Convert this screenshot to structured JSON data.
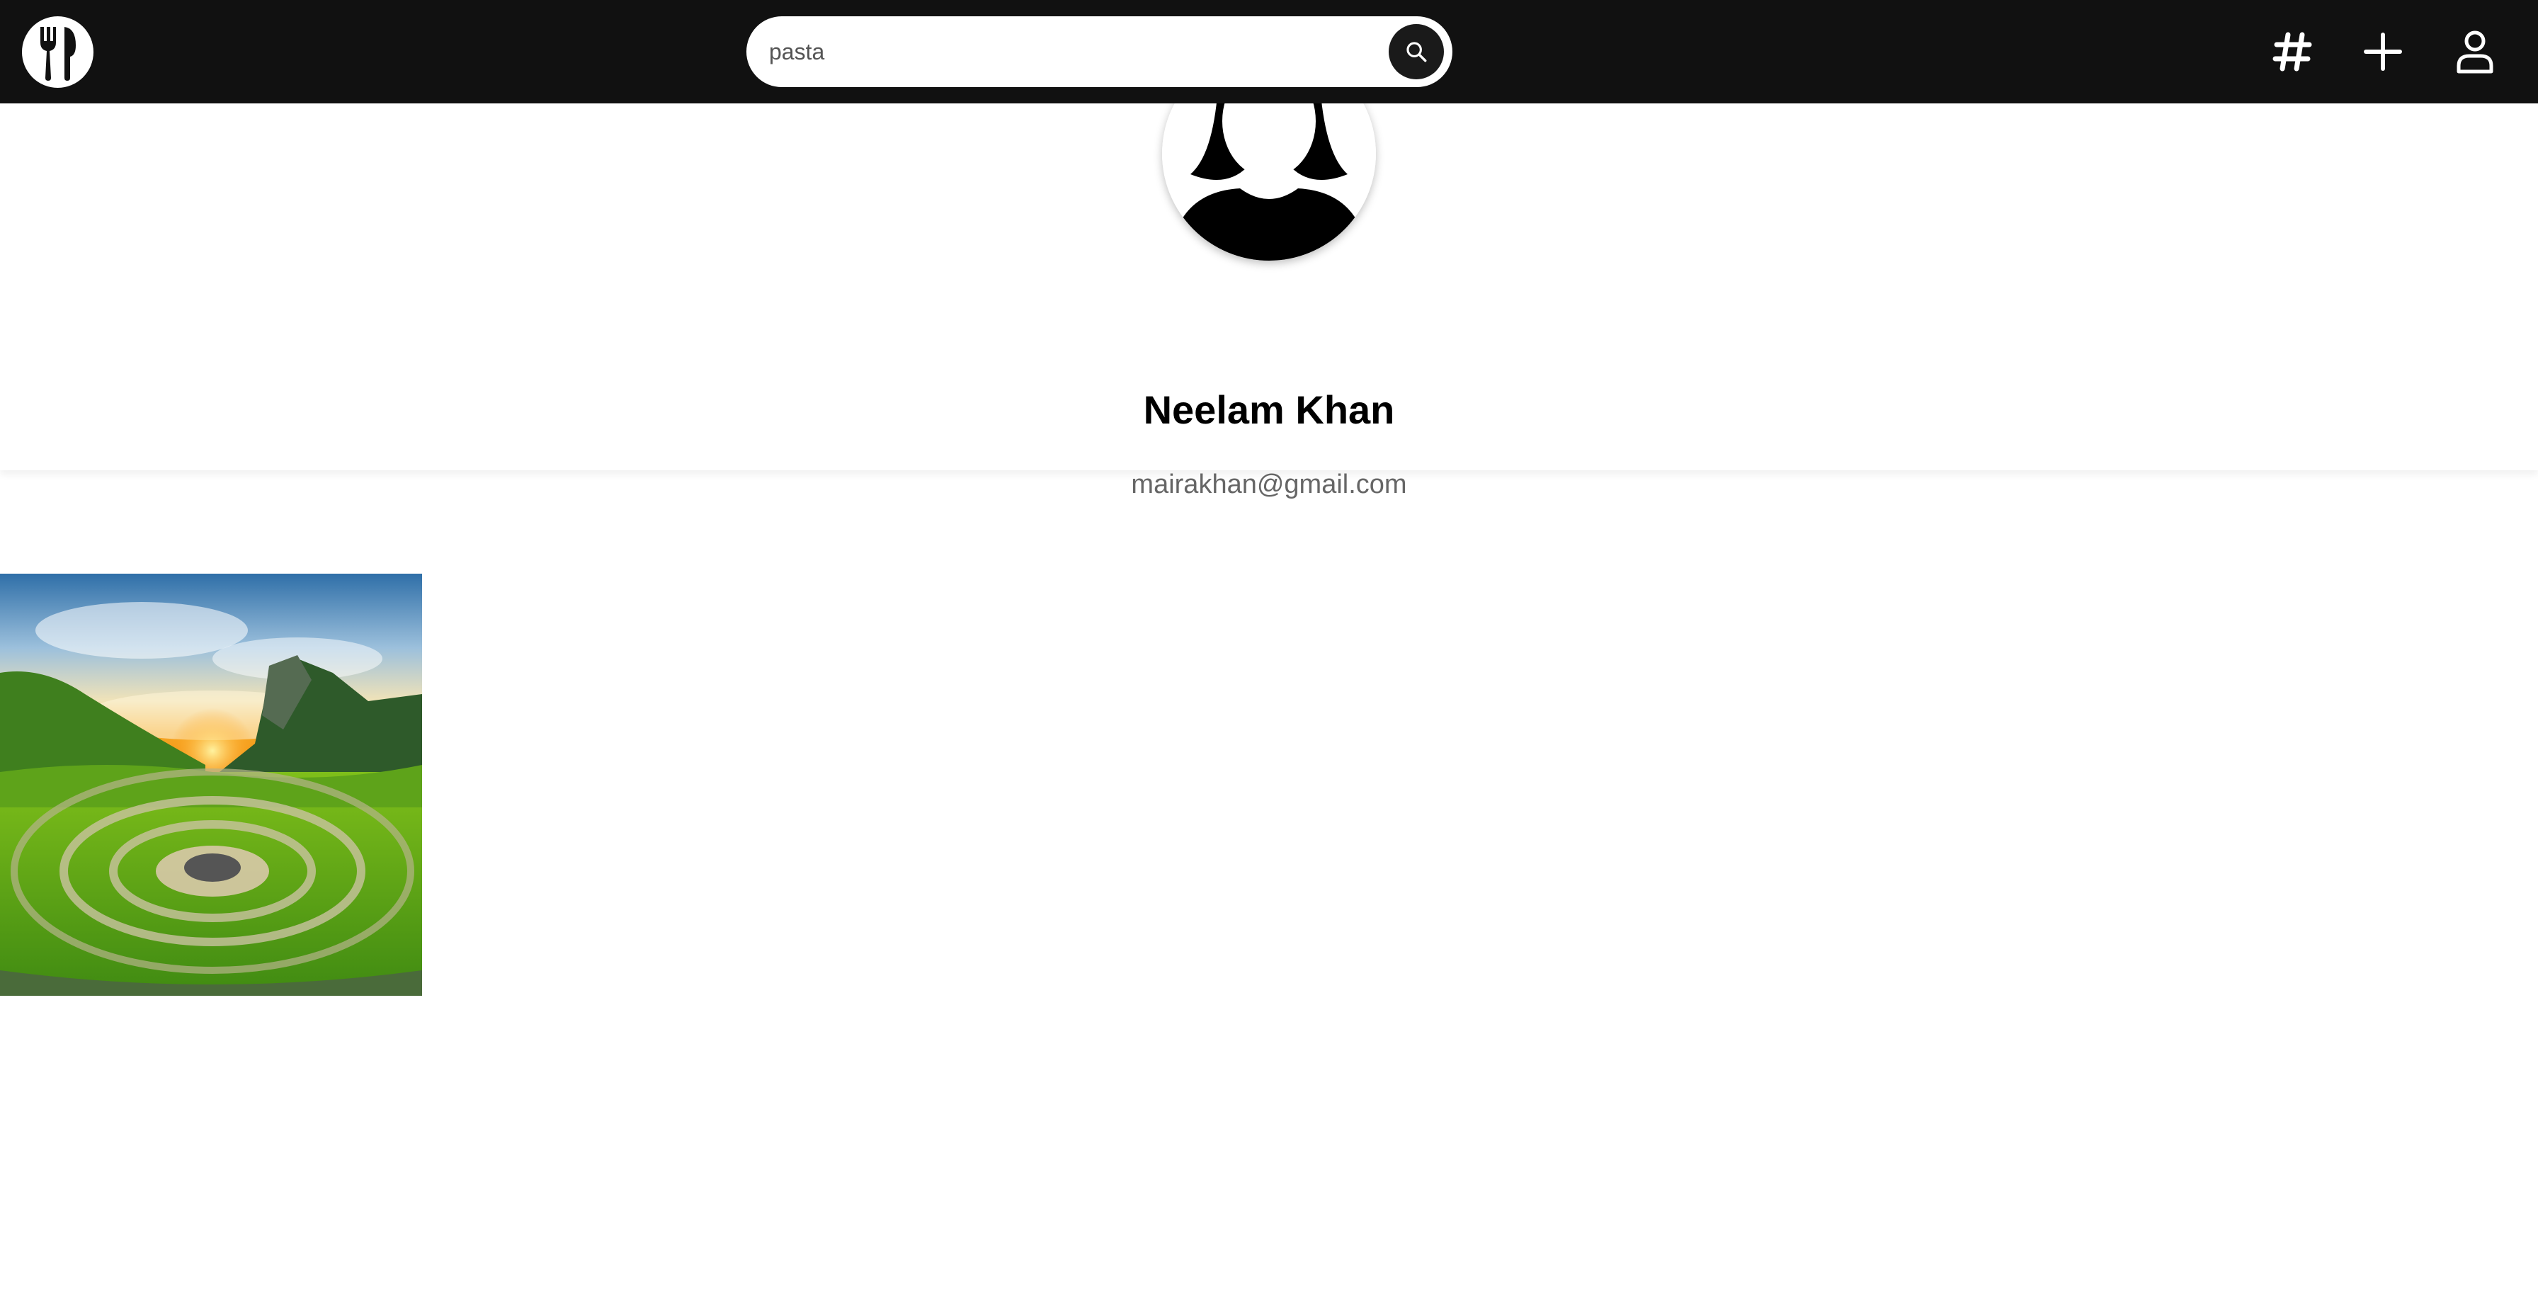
{
  "header": {
    "logo_icon": "fork-spoon-icon",
    "search": {
      "value": "pasta",
      "placeholder": "pasta",
      "button_icon": "search-icon"
    },
    "nav": [
      {
        "icon": "hashtag-icon"
      },
      {
        "icon": "plus-icon"
      },
      {
        "icon": "user-icon"
      }
    ],
    "bg_color": "#111111"
  },
  "profile": {
    "avatar_icon": "female-avatar-icon",
    "name": "Neelam Khan",
    "email": "mairakhan@gmail.com"
  },
  "posts": [
    {
      "image": "landscape-green-valley-sunset"
    }
  ]
}
